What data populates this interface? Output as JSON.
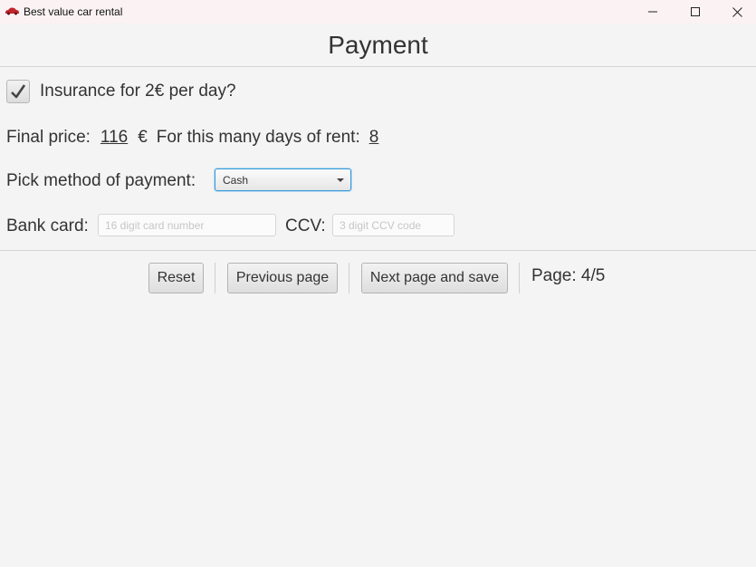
{
  "window": {
    "title": "Best value car rental",
    "controls": [
      "minimize",
      "maximize",
      "close"
    ]
  },
  "header": {
    "title": "Payment"
  },
  "insurance": {
    "label": "Insurance for 2€ per day?",
    "checked": true
  },
  "price": {
    "label": "Final price:",
    "value": "116",
    "currency": "€",
    "days_label": "For this many days of rent:",
    "days_value": "8"
  },
  "payment": {
    "label": "Pick method of payment:",
    "selected": "Cash"
  },
  "bank_card": {
    "label": "Bank card:",
    "card_placeholder": "16 digit card number",
    "ccv_label": "CCV:",
    "ccv_placeholder": "3 digit CCV code"
  },
  "footer": {
    "reset_label": "Reset",
    "previous_label": "Previous page",
    "next_label": "Next page and save",
    "page_indicator": "Page: 4/5"
  },
  "colors": {
    "focus_accent": "#3a9ad9",
    "background": "#f4f4f4",
    "titlebar": "#fbf3f3",
    "app_icon": "#c0262d"
  },
  "icons": {
    "app": "car-icon",
    "checkbox": "checkmark-icon",
    "dropdown": "chevron-down-icon"
  }
}
